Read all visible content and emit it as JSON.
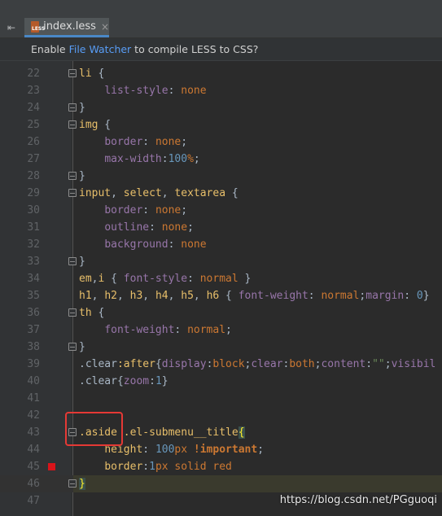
{
  "editor": {
    "tab_title": "index.less",
    "tab_close": "×",
    "file_icon_text": "LESS",
    "tool_icon": "⇤"
  },
  "notice": {
    "prefix": "Enable ",
    "link": "File Watcher",
    "suffix": " to compile LESS to CSS?"
  },
  "watermark": "https://blog.csdn.net/PGguoqi",
  "lines": [
    {
      "n": "22",
      "parts": [
        [
          "li",
          "sel"
        ],
        [
          " {",
          "p"
        ]
      ]
    },
    {
      "n": "23",
      "parts": [
        [
          "    ",
          "p"
        ],
        [
          "list-style",
          "prop"
        ],
        [
          ": ",
          "p"
        ],
        [
          "none",
          "kw"
        ]
      ]
    },
    {
      "n": "24",
      "parts": [
        [
          "}",
          "p"
        ]
      ]
    },
    {
      "n": "25",
      "parts": [
        [
          "img",
          "sel"
        ],
        [
          " {",
          "p"
        ]
      ]
    },
    {
      "n": "26",
      "parts": [
        [
          "    ",
          "p"
        ],
        [
          "border",
          "prop"
        ],
        [
          ": ",
          "p"
        ],
        [
          "none",
          "kw"
        ],
        [
          ";",
          "p"
        ]
      ]
    },
    {
      "n": "27",
      "parts": [
        [
          "    ",
          "p"
        ],
        [
          "max-width",
          "prop"
        ],
        [
          ":",
          "p"
        ],
        [
          "100",
          "num"
        ],
        [
          "%",
          "kw"
        ],
        [
          ";",
          "p"
        ]
      ]
    },
    {
      "n": "28",
      "parts": [
        [
          "}",
          "p"
        ]
      ]
    },
    {
      "n": "29",
      "parts": [
        [
          "input",
          "sel"
        ],
        [
          ", ",
          "p"
        ],
        [
          "select",
          "sel"
        ],
        [
          ", ",
          "p"
        ],
        [
          "textarea",
          "sel"
        ],
        [
          " {",
          "p"
        ]
      ]
    },
    {
      "n": "30",
      "parts": [
        [
          "    ",
          "p"
        ],
        [
          "border",
          "prop"
        ],
        [
          ": ",
          "p"
        ],
        [
          "none",
          "kw"
        ],
        [
          ";",
          "p"
        ]
      ]
    },
    {
      "n": "31",
      "parts": [
        [
          "    ",
          "p"
        ],
        [
          "outline",
          "prop"
        ],
        [
          ": ",
          "p"
        ],
        [
          "none",
          "kw"
        ],
        [
          ";",
          "p"
        ]
      ]
    },
    {
      "n": "32",
      "parts": [
        [
          "    ",
          "p"
        ],
        [
          "background",
          "prop"
        ],
        [
          ": ",
          "p"
        ],
        [
          "none",
          "kw"
        ]
      ]
    },
    {
      "n": "33",
      "parts": [
        [
          "}",
          "p"
        ]
      ]
    },
    {
      "n": "34",
      "parts": [
        [
          "em",
          "sel"
        ],
        [
          ",",
          "p"
        ],
        [
          "i",
          "sel"
        ],
        [
          " { ",
          "p"
        ],
        [
          "font-style",
          "prop"
        ],
        [
          ": ",
          "p"
        ],
        [
          "normal",
          "kw"
        ],
        [
          " }",
          "p"
        ]
      ]
    },
    {
      "n": "35",
      "parts": [
        [
          "h1",
          "sel"
        ],
        [
          ", ",
          "p"
        ],
        [
          "h2",
          "sel"
        ],
        [
          ", ",
          "p"
        ],
        [
          "h3",
          "sel"
        ],
        [
          ", ",
          "p"
        ],
        [
          "h4",
          "sel"
        ],
        [
          ", ",
          "p"
        ],
        [
          "h5",
          "sel"
        ],
        [
          ", ",
          "p"
        ],
        [
          "h6",
          "sel"
        ],
        [
          " { ",
          "p"
        ],
        [
          "font-weight",
          "prop"
        ],
        [
          ": ",
          "p"
        ],
        [
          "normal",
          "kw"
        ],
        [
          ";",
          "p"
        ],
        [
          "margin",
          "prop"
        ],
        [
          ": ",
          "p"
        ],
        [
          "0",
          "num"
        ],
        [
          "}",
          "p"
        ]
      ]
    },
    {
      "n": "36",
      "parts": [
        [
          "th",
          "sel"
        ],
        [
          " {",
          "p"
        ]
      ]
    },
    {
      "n": "37",
      "parts": [
        [
          "    ",
          "p"
        ],
        [
          "font-weight",
          "prop"
        ],
        [
          ": ",
          "p"
        ],
        [
          "normal",
          "kw"
        ],
        [
          ";",
          "p"
        ]
      ]
    },
    {
      "n": "38",
      "parts": [
        [
          "}",
          "p"
        ]
      ]
    },
    {
      "n": "39",
      "parts": [
        [
          ".clear",
          "cls"
        ],
        [
          ":after",
          "sel"
        ],
        [
          "{",
          "p"
        ],
        [
          "display",
          "prop"
        ],
        [
          ":",
          "p"
        ],
        [
          "block",
          "kw"
        ],
        [
          ";",
          "p"
        ],
        [
          "clear",
          "prop"
        ],
        [
          ":",
          "p"
        ],
        [
          "both",
          "kw"
        ],
        [
          ";",
          "p"
        ],
        [
          "content",
          "prop"
        ],
        [
          ":",
          "p"
        ],
        [
          "\"\"",
          "str"
        ],
        [
          ";",
          "p"
        ],
        [
          "visibil",
          "prop"
        ]
      ]
    },
    {
      "n": "40",
      "parts": [
        [
          ".clear",
          "cls"
        ],
        [
          "{",
          "p"
        ],
        [
          "zoom",
          "prop"
        ],
        [
          ":",
          "p"
        ],
        [
          "1",
          "num"
        ],
        [
          "}",
          "p"
        ]
      ]
    },
    {
      "n": "41",
      "parts": [
        [
          "",
          "p"
        ]
      ]
    },
    {
      "n": "42",
      "parts": [
        [
          "",
          "p"
        ]
      ]
    },
    {
      "n": "43",
      "parts": [
        [
          ".aside",
          "sel"
        ],
        [
          " ",
          "p"
        ],
        [
          ".el-submenu__title",
          "sel"
        ],
        [
          "{",
          "bh"
        ]
      ]
    },
    {
      "n": "44",
      "parts": [
        [
          "    ",
          "p"
        ],
        [
          "height",
          "sel"
        ],
        [
          ": ",
          "p"
        ],
        [
          "100",
          "num"
        ],
        [
          "px",
          "kw"
        ],
        [
          " ",
          "p"
        ],
        [
          "!important",
          "imp"
        ],
        [
          ";",
          "p"
        ]
      ]
    },
    {
      "n": "45",
      "parts": [
        [
          "    ",
          "p"
        ],
        [
          "border",
          "sel"
        ],
        [
          ":",
          "p"
        ],
        [
          "1",
          "num"
        ],
        [
          "px solid red",
          "kw"
        ]
      ]
    },
    {
      "n": "46",
      "parts": [
        [
          "}",
          "bh"
        ]
      ]
    },
    {
      "n": "47",
      "parts": [
        [
          "",
          "p"
        ]
      ]
    }
  ]
}
